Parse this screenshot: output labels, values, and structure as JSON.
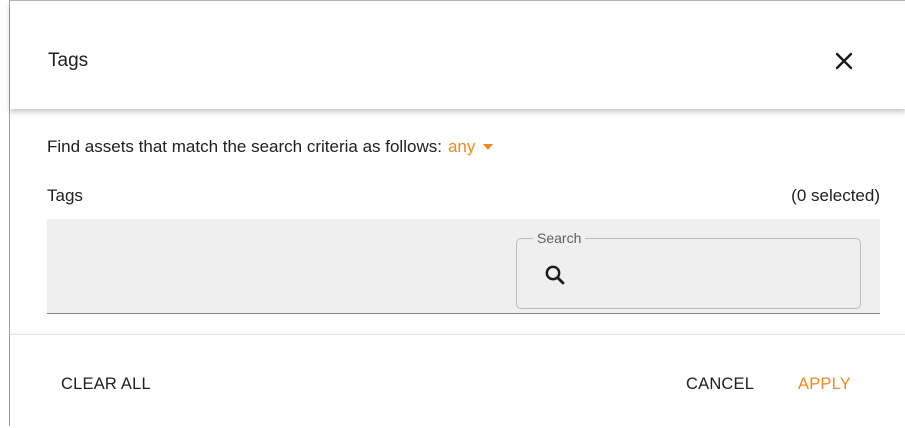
{
  "dialog": {
    "title": "Tags",
    "close_icon": "close-icon"
  },
  "criteria": {
    "prefix": "Find assets that match the search criteria as follows:",
    "match_value": "any",
    "accent_color": "#f08a1c"
  },
  "tags": {
    "label": "Tags",
    "selected_count": "(0 selected)",
    "search": {
      "legend": "Search",
      "icon": "search-icon",
      "value": ""
    }
  },
  "footer": {
    "clear_all_label": "CLEAR ALL",
    "cancel_label": "CANCEL",
    "apply_label": "APPLY"
  }
}
